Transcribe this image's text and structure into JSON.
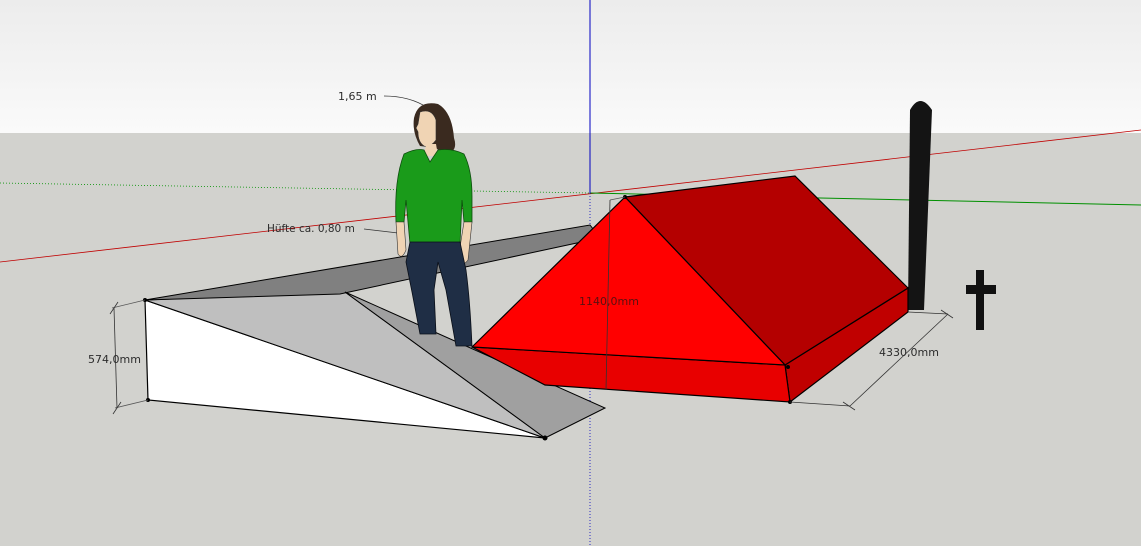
{
  "viewport": {
    "sky_top_color": "#ececec",
    "sky_bottom_color": "#fafafa",
    "ground_color": "#d2d2ce"
  },
  "axes": {
    "red_axis_color": "#c00000",
    "green_axis_color": "#009000",
    "blue_axis_color": "#0000c0"
  },
  "model": {
    "roof_colors": {
      "front": "#ff0000",
      "side": "#b40000",
      "base_front": "#e80000",
      "base_side": "#c00000"
    },
    "ramp_colors": {
      "white_face": "#ffffff",
      "grey_top": "#bfbfbf",
      "dark_strip": "#808080"
    },
    "person_colors": {
      "shirt": "#1a9b1a",
      "jeans": "#1f2e45",
      "hair": "#3a2a1f",
      "skin": "#f0d4b4"
    },
    "post_color": "#141414",
    "cross_color": "#111111"
  },
  "dimensions": {
    "person_height": "1,65 m",
    "hip_height": "Hüfte ca. 0,80 m",
    "ramp_height": "574,0mm",
    "roof_height": "1140,0mm",
    "roof_depth": "4330,0mm"
  }
}
